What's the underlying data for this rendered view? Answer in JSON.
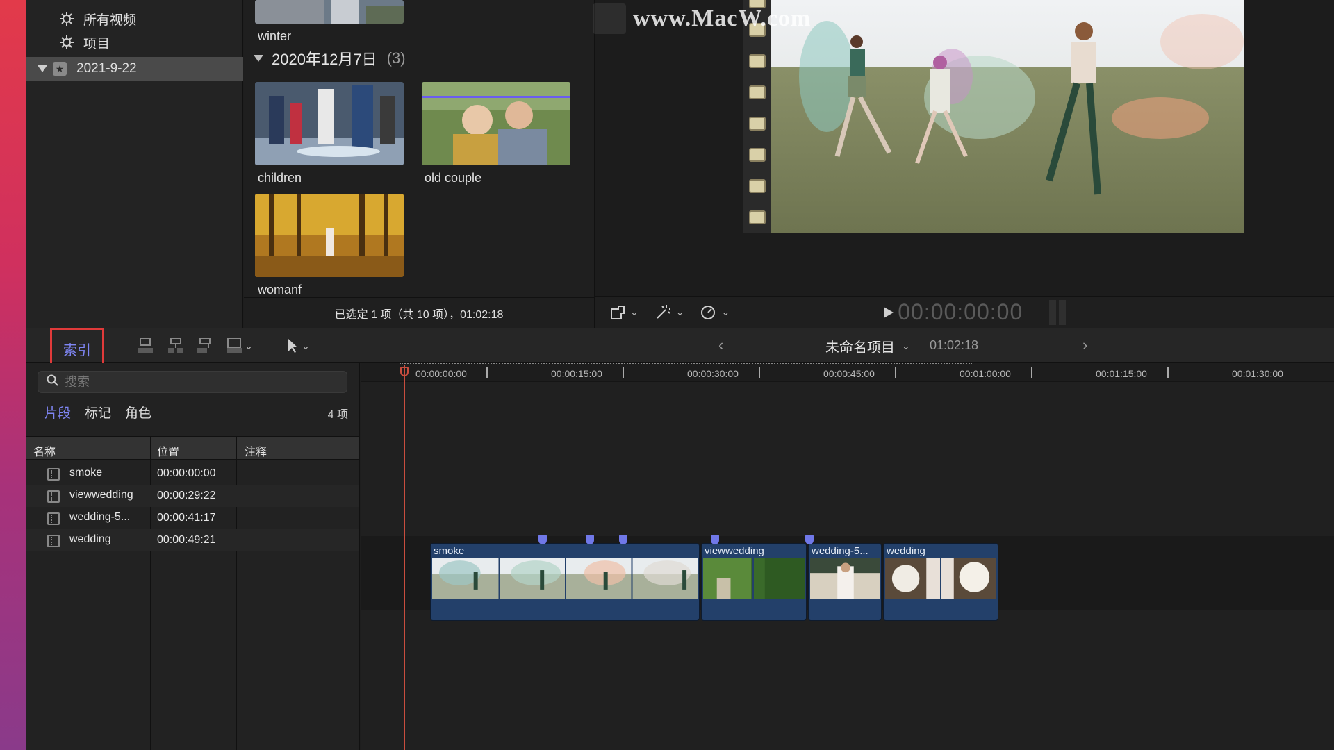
{
  "libraries": {
    "items": [
      {
        "label": "所有视频",
        "icon": "smart-collection-gear-icon"
      },
      {
        "label": "项目",
        "icon": "smart-collection-gear-icon"
      }
    ],
    "event": {
      "label": "2021-9-22",
      "icon": "event-star-icon"
    }
  },
  "browser": {
    "clips_above": [
      {
        "name": "winter"
      }
    ],
    "group": {
      "title": "2020年12月7日",
      "count": "(3)"
    },
    "clips": [
      {
        "name": "children"
      },
      {
        "name": "old couple"
      },
      {
        "name": "womanf"
      }
    ],
    "status": "已选定 1 项（共 10 项），01:02:18"
  },
  "viewer": {
    "watermark": "www.MacW.com",
    "timecode": "00:00:00:00"
  },
  "timeline_toolbar": {
    "index_label": "索引",
    "project_name": "未命名项目",
    "project_duration": "01:02:18"
  },
  "timeline_index": {
    "search_placeholder": "搜索",
    "tabs": [
      {
        "label": "片段",
        "active": true
      },
      {
        "label": "标记",
        "active": false
      },
      {
        "label": "角色",
        "active": false
      }
    ],
    "count": "4 项",
    "columns": {
      "name": "名称",
      "position": "位置",
      "notes": "注释"
    },
    "rows": [
      {
        "name": "smoke",
        "position": "00:00:00:00"
      },
      {
        "name": "viewwedding",
        "position": "00:00:29:22"
      },
      {
        "name": "wedding-5...",
        "position": "00:00:41:17"
      },
      {
        "name": "wedding",
        "position": "00:00:49:21"
      }
    ]
  },
  "timeline": {
    "ruler_labels": [
      "00:00:00:00",
      "00:00:15:00",
      "00:00:30:00",
      "00:00:45:00",
      "00:01:00:00",
      "00:01:15:00",
      "00:01:30:00"
    ],
    "clips": [
      {
        "name": "smoke"
      },
      {
        "name": "viewwedding"
      },
      {
        "name": "wedding-5..."
      },
      {
        "name": "wedding"
      }
    ]
  },
  "colors": {
    "accent": "#7f86f4",
    "clip_blue": "#23406a",
    "playhead": "#c94d3e",
    "highlight_box": "#e03a3a"
  }
}
